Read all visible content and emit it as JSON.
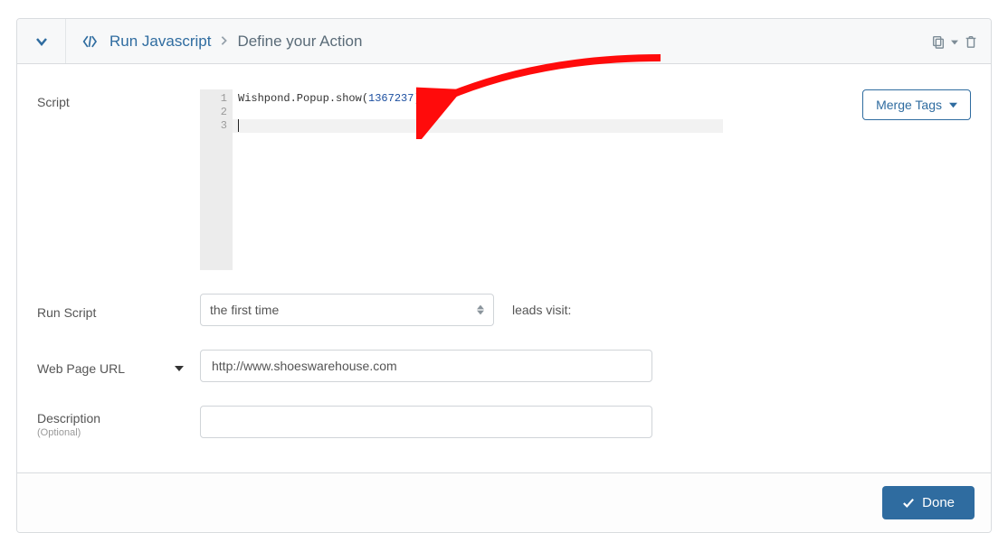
{
  "header": {
    "breadcrumb_link": "Run Javascript",
    "breadcrumb_current": "Define your Action"
  },
  "toolbar": {
    "merge_tags_label": "Merge Tags"
  },
  "fields": {
    "script_label": "Script",
    "run_script_label": "Run Script",
    "run_script_value": "the first time",
    "leads_visit_label": "leads visit:",
    "url_label": "Web Page URL",
    "url_value": "http://www.shoeswarehouse.com",
    "description_label": "Description",
    "description_sub": "(Optional)",
    "description_value": ""
  },
  "editor": {
    "code_prefix": "Wishpond.Popup.show(",
    "code_num": "1367237",
    "code_suffix": ");",
    "lines": [
      "1",
      "2",
      "3"
    ]
  },
  "footer": {
    "done_label": "Done"
  },
  "colors": {
    "accent": "#2f6ca0",
    "arrow": "#ff0b0b"
  }
}
